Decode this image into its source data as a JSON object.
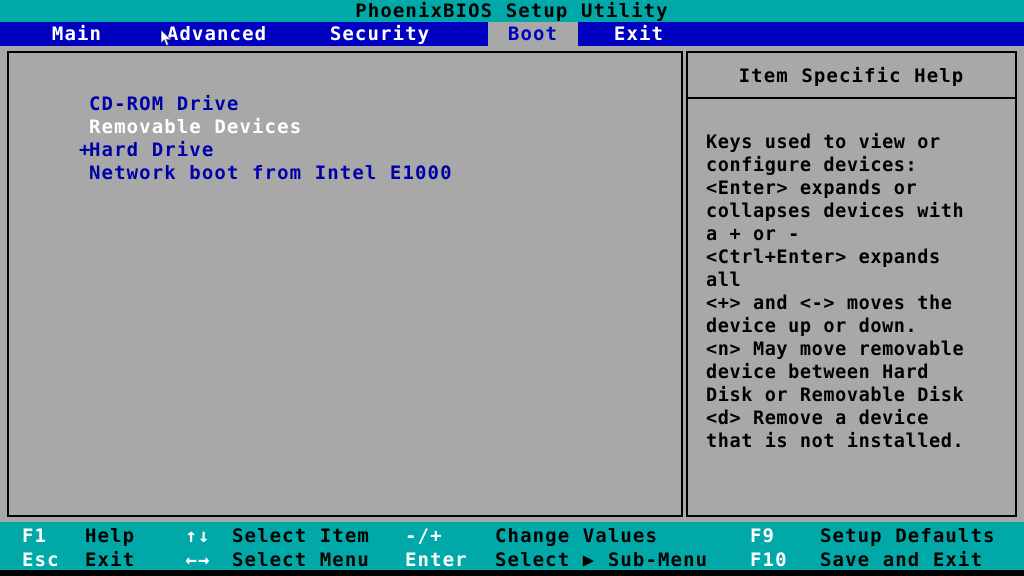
{
  "title": "PhoenixBIOS Setup Utility",
  "menu": {
    "tabs": [
      {
        "label": "Main",
        "active": false
      },
      {
        "label": "Advanced",
        "active": false
      },
      {
        "label": "Security",
        "active": false
      },
      {
        "label": "Boot",
        "active": true
      },
      {
        "label": "Exit",
        "active": false
      }
    ]
  },
  "boot": {
    "devices": [
      {
        "prefix": " ",
        "label": "CD-ROM Drive",
        "selected": false
      },
      {
        "prefix": " ",
        "label": "Removable Devices",
        "selected": true
      },
      {
        "prefix": "+",
        "label": "Hard Drive",
        "selected": false
      },
      {
        "prefix": " ",
        "label": "Network boot from Intel E1000",
        "selected": false
      }
    ]
  },
  "help": {
    "title": "Item Specific Help",
    "lines": [
      "Keys used to view or",
      "configure devices:",
      "<Enter> expands or",
      "collapses devices with",
      "a + or -",
      "<Ctrl+Enter> expands",
      "all",
      "<+> and <-> moves the",
      "device up or down.",
      "<n> May move removable",
      "device between Hard",
      "Disk or Removable Disk",
      "<d> Remove a device",
      "that is not installed."
    ]
  },
  "footer": {
    "row1": {
      "key1": "F1",
      "desc1": "Help",
      "arrow": "↑↓",
      "desc2": "Select Item",
      "key2": "-/+",
      "desc3": "Change Values",
      "key3": "F9",
      "desc4": "Setup Defaults"
    },
    "row2": {
      "key1": "Esc",
      "desc1": "Exit",
      "arrow": "←→",
      "desc2": "Select Menu",
      "key2": "Enter",
      "desc3": "Select ▶ Sub-Menu",
      "key3": "F10",
      "desc4": "Save and Exit"
    }
  },
  "colors": {
    "title_bar": "#00a8a8",
    "menu_bar": "#0000c0",
    "work_area": "#a8a8a8",
    "text_blue": "#0000a8",
    "text_white": "#ffffff",
    "footer": "#00a8a8"
  }
}
